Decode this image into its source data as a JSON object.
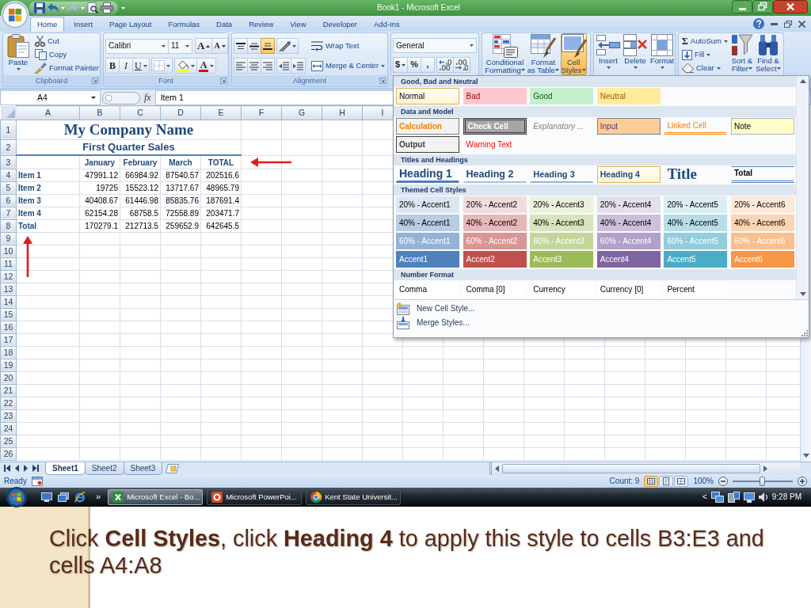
{
  "title_bar": {
    "title": "Book1 - Microsoft Excel"
  },
  "tabs": [
    {
      "label": "Home",
      "selected": true
    },
    {
      "label": "Insert",
      "selected": false
    },
    {
      "label": "Page Layout",
      "selected": false
    },
    {
      "label": "Formulas",
      "selected": false
    },
    {
      "label": "Data",
      "selected": false
    },
    {
      "label": "Review",
      "selected": false
    },
    {
      "label": "View",
      "selected": false
    },
    {
      "label": "Developer",
      "selected": false
    },
    {
      "label": "Add-Ins",
      "selected": false
    }
  ],
  "ribbon": {
    "clipboard": {
      "label": "Clipboard",
      "paste": "Paste",
      "cut": "Cut",
      "copy": "Copy",
      "format_painter": "Format Painter"
    },
    "font": {
      "label": "Font",
      "font_name": "Calibri",
      "font_size": "11",
      "grow_font": "A",
      "shrink_font": "A",
      "bold": "B",
      "italic": "I",
      "underline": "U",
      "font_color": "A"
    },
    "alignment": {
      "label": "Alignment",
      "vertical_align": [
        {
          "kind": "top",
          "selected": false
        },
        {
          "kind": "middle",
          "selected": false
        },
        {
          "kind": "bottom",
          "selected": true
        }
      ],
      "wrap_text": "Wrap Text",
      "merge_center": "Merge & Center"
    },
    "number": {
      "format": "General",
      "currency": "$",
      "percent": "%",
      "comma": ","
    },
    "styles": [
      {
        "label": "Conditional Formatting",
        "kind": "conditional",
        "selected": false
      },
      {
        "label": "Format as Table",
        "kind": "table",
        "selected": false
      },
      {
        "label": "Cell Styles",
        "kind": "cellstyles",
        "selected": true
      }
    ],
    "cells": [
      {
        "label": "Insert",
        "kind": "insert"
      },
      {
        "label": "Delete",
        "kind": "delete"
      },
      {
        "label": "Format",
        "kind": "format"
      }
    ],
    "editing": {
      "autosum_symbol": "Σ",
      "autosum": "AutoSum",
      "fill": "Fill",
      "clear": "Clear",
      "sort_filter": "Sort & Filter",
      "find_select": "Find & Select"
    }
  },
  "cell_styles_gallery": {
    "sections": [
      {
        "title": "Good, Bad and Neutral",
        "items": [
          {
            "label": "Normal",
            "kind": "normal",
            "highlighted": true
          },
          {
            "label": "Bad",
            "kind": "bad",
            "highlighted": false
          },
          {
            "label": "Good",
            "kind": "good",
            "highlighted": false
          },
          {
            "label": "Neutral",
            "kind": "neutral",
            "highlighted": false
          }
        ]
      },
      {
        "title": "Data and Model",
        "items": [
          {
            "label": "Calculation",
            "kind": "calculation",
            "highlighted": false
          },
          {
            "label": "Check Cell",
            "kind": "check",
            "highlighted": false
          },
          {
            "label": "Explanatory ...",
            "kind": "explanatory",
            "highlighted": false
          },
          {
            "label": "Input",
            "kind": "input",
            "highlighted": false
          },
          {
            "label": "Linked Cell",
            "kind": "linked",
            "highlighted": false
          },
          {
            "label": "Note",
            "kind": "note",
            "highlighted": false
          },
          {
            "label": "Output",
            "kind": "output",
            "highlighted": false
          },
          {
            "label": "Warning Text",
            "kind": "warning",
            "highlighted": false
          }
        ]
      },
      {
        "title": "Titles and Headings",
        "items": [
          {
            "label": "Heading 1",
            "kind": "heading1",
            "highlighted": false
          },
          {
            "label": "Heading 2",
            "kind": "heading2",
            "highlighted": false
          },
          {
            "label": "Heading 3",
            "kind": "heading3",
            "highlighted": false
          },
          {
            "label": "Heading 4",
            "kind": "heading4",
            "highlighted": true
          },
          {
            "label": "Title",
            "kind": "title",
            "highlighted": false
          },
          {
            "label": "Total",
            "kind": "total",
            "highlighted": false
          }
        ]
      },
      {
        "title": "Themed Cell Styles",
        "items": [
          {
            "label": "20% - Accent1",
            "kind": "pale",
            "color": "#dce6f1",
            "highlighted": false
          },
          {
            "label": "20% - Accent2",
            "kind": "pale",
            "color": "#f2dcdb",
            "highlighted": false
          },
          {
            "label": "20% - Accent3",
            "kind": "pale",
            "color": "#ebf1de",
            "highlighted": false
          },
          {
            "label": "20% - Accent4",
            "kind": "pale",
            "color": "#e4dfec",
            "highlighted": false
          },
          {
            "label": "20% - Accent5",
            "kind": "pale",
            "color": "#daeef3",
            "highlighted": false
          },
          {
            "label": "20% - Accent6",
            "kind": "pale",
            "color": "#fde9d9",
            "highlighted": false
          },
          {
            "label": "40% - Accent1",
            "kind": "pale",
            "color": "#b8cce4",
            "highlighted": false
          },
          {
            "label": "40% - Accent2",
            "kind": "pale",
            "color": "#e6b8b7",
            "highlighted": false
          },
          {
            "label": "40% - Accent3",
            "kind": "pale",
            "color": "#d8e4bc",
            "highlighted": false
          },
          {
            "label": "40% - Accent4",
            "kind": "pale",
            "color": "#ccc0da",
            "highlighted": false
          },
          {
            "label": "40% - Accent5",
            "kind": "pale",
            "color": "#b7dee8",
            "highlighted": false
          },
          {
            "label": "40% - Accent6",
            "kind": "pale",
            "color": "#fcd5b4",
            "highlighted": false
          },
          {
            "label": "60% - Accent1",
            "kind": "strong",
            "color": "#95b3d7",
            "highlighted": false
          },
          {
            "label": "60% - Accent2",
            "kind": "strong",
            "color": "#da9694",
            "highlighted": false
          },
          {
            "label": "60% - Accent3",
            "kind": "strong",
            "color": "#c4d79b",
            "highlighted": false
          },
          {
            "label": "60% - Accent4",
            "kind": "strong",
            "color": "#b1a0c7",
            "highlighted": false
          },
          {
            "label": "60% - Accent5",
            "kind": "strong",
            "color": "#92cddc",
            "highlighted": false
          },
          {
            "label": "60% - Accent6",
            "kind": "strong",
            "color": "#fabf8f",
            "highlighted": false
          },
          {
            "label": "Accent1",
            "kind": "strong",
            "color": "#4f81bd",
            "highlighted": false
          },
          {
            "label": "Accent2",
            "kind": "strong",
            "color": "#c0504d",
            "highlighted": false
          },
          {
            "label": "Accent3",
            "kind": "strong",
            "color": "#9bbb59",
            "highlighted": false
          },
          {
            "label": "Accent4",
            "kind": "strong",
            "color": "#8064a2",
            "highlighted": false
          },
          {
            "label": "Accent5",
            "kind": "strong",
            "color": "#4bacc6",
            "highlighted": false
          },
          {
            "label": "Accent6",
            "kind": "strong",
            "color": "#f79646",
            "highlighted": false
          }
        ]
      },
      {
        "title": "Number Format",
        "items": [
          {
            "label": "Comma",
            "kind": "number",
            "highlighted": false
          },
          {
            "label": "Comma [0]",
            "kind": "number",
            "highlighted": false
          },
          {
            "label": "Currency",
            "kind": "number",
            "highlighted": false
          },
          {
            "label": "Currency [0]",
            "kind": "number",
            "highlighted": false
          },
          {
            "label": "Percent",
            "kind": "number",
            "highlighted": false
          }
        ]
      }
    ],
    "commands": [
      {
        "label": "New Cell Style...",
        "kind": "new"
      },
      {
        "label": "Merge Styles...",
        "kind": "merge"
      }
    ]
  },
  "formula_bar": {
    "name_box": "A4",
    "function_symbol": "fx",
    "content": "Item 1"
  },
  "sheet": {
    "columns": [
      "A",
      "B",
      "C",
      "D",
      "E",
      "F",
      "G",
      "H",
      "I"
    ],
    "rows": [
      {
        "number": "1",
        "kind": "title",
        "text": "My Company Name"
      },
      {
        "number": "2",
        "kind": "subtitle",
        "text": "First Quarter Sales"
      },
      {
        "number": "3",
        "kind": "header",
        "values": [
          "January",
          "February",
          "March",
          "TOTAL"
        ]
      },
      {
        "number": "4",
        "kind": "data",
        "label": "Item 1",
        "values": [
          "47991.12",
          "66984.92",
          "87540.57",
          "202516.6"
        ]
      },
      {
        "number": "5",
        "kind": "data",
        "label": "Item 2",
        "values": [
          "19725",
          "15523.12",
          "13717.67",
          "48965.79"
        ]
      },
      {
        "number": "6",
        "kind": "data",
        "label": "Item 3",
        "values": [
          "40408.67",
          "61446.98",
          "85835.76",
          "187691.4"
        ]
      },
      {
        "number": "7",
        "kind": "data",
        "label": "Item 4",
        "values": [
          "62154.28",
          "68758.5",
          "72558.89",
          "203471.7"
        ]
      },
      {
        "number": "8",
        "kind": "data",
        "label": "Total",
        "values": [
          "170279.1",
          "212713.5",
          "259652.9",
          "642645.5"
        ]
      },
      {
        "number": "9",
        "kind": "empty"
      },
      {
        "number": "10",
        "kind": "empty"
      },
      {
        "number": "11",
        "kind": "empty"
      },
      {
        "number": "12",
        "kind": "empty"
      },
      {
        "number": "13",
        "kind": "empty"
      },
      {
        "number": "14",
        "kind": "empty"
      },
      {
        "number": "15",
        "kind": "empty"
      },
      {
        "number": "16",
        "kind": "empty"
      },
      {
        "number": "17",
        "kind": "empty"
      },
      {
        "number": "18",
        "kind": "empty"
      },
      {
        "number": "19",
        "kind": "empty"
      },
      {
        "number": "20",
        "kind": "empty"
      },
      {
        "number": "21",
        "kind": "empty"
      },
      {
        "number": "22",
        "kind": "empty"
      },
      {
        "number": "23",
        "kind": "empty"
      },
      {
        "number": "24",
        "kind": "empty"
      },
      {
        "number": "25",
        "kind": "empty"
      },
      {
        "number": "26",
        "kind": "empty"
      }
    ]
  },
  "sheet_tabs": [
    {
      "label": "Sheet1",
      "selected": true
    },
    {
      "label": "Sheet2",
      "selected": false
    },
    {
      "label": "Sheet3",
      "selected": false
    }
  ],
  "status_bar": {
    "status": "Ready",
    "count": "Count: 9",
    "views": [
      {
        "kind": "normal",
        "selected": true
      },
      {
        "kind": "layout",
        "selected": false
      },
      {
        "kind": "pagebreak",
        "selected": false
      }
    ],
    "zoom": "100%",
    "zoom_slider": {
      "level": 0.5
    }
  },
  "taskbar": {
    "overflow": "»",
    "tasks": [
      {
        "label": "Microsoft Excel - Bo...",
        "kind": "excel",
        "selected": true
      },
      {
        "label": "Microsoft PowerPoi...",
        "kind": "powerpoint",
        "selected": false
      },
      {
        "label": "Kent State Universit...",
        "kind": "browser",
        "selected": false
      }
    ],
    "tray_toggle": "<",
    "clock": "9:28 PM"
  },
  "caption": "Click **Cell Styles**, click **Heading 4** to apply this style to cells B3:E3 and cells A4:A8"
}
